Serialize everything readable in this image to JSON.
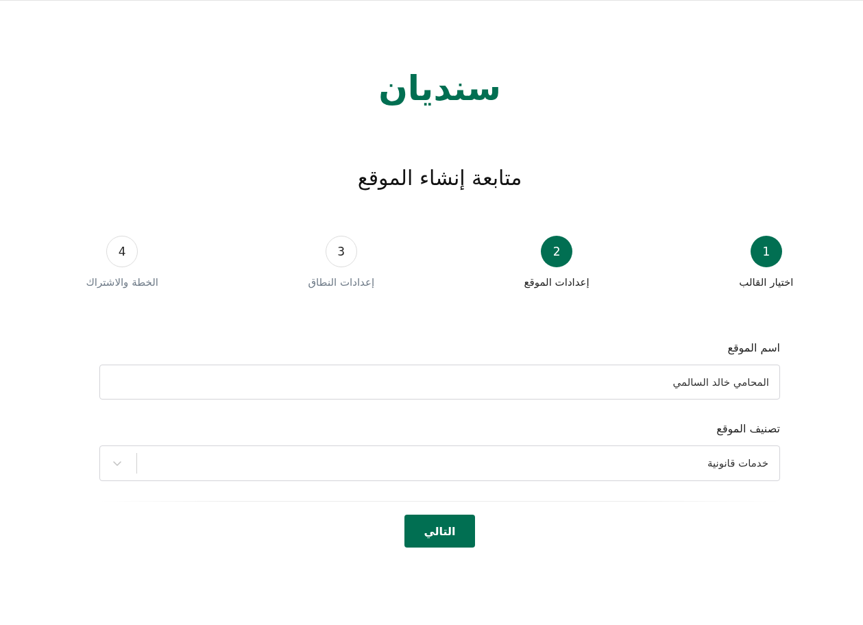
{
  "logo": {
    "text": "سنديان"
  },
  "title": "متابعة إنشاء الموقع",
  "steps": [
    {
      "number": "1",
      "label": "اختيار القالب",
      "active": true
    },
    {
      "number": "2",
      "label": "إعدادات الموقع",
      "active": true
    },
    {
      "number": "3",
      "label": "إعدادات النطاق",
      "active": false
    },
    {
      "number": "4",
      "label": "الخطة والاشتراك",
      "active": false
    }
  ],
  "form": {
    "fields": [
      {
        "kind": "text",
        "label": "اسم الموقع",
        "value": "المحامي خالد السالمي"
      },
      {
        "kind": "select",
        "label": "تصنيف الموقع",
        "value": "خدمات قانونية"
      }
    ]
  },
  "next_button": {
    "label": "التالي"
  }
}
